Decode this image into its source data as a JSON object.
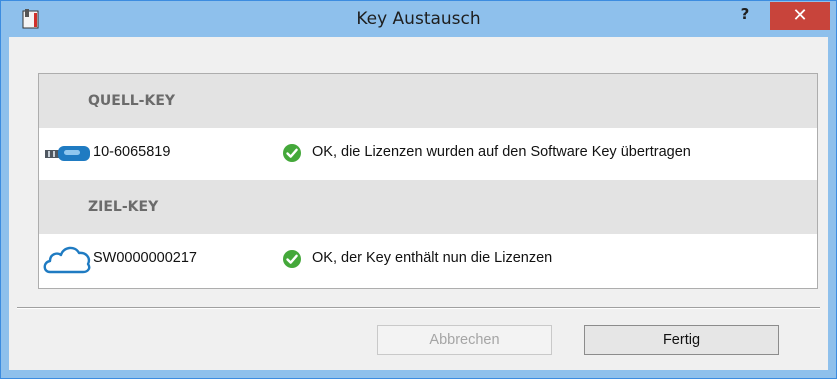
{
  "window": {
    "title": "Key Austausch",
    "help_label": "?",
    "close_label": "✕",
    "colors": {
      "titlebar": "#8ec0ec",
      "close": "#c8443b",
      "ok": "#44a83a"
    }
  },
  "sections": [
    {
      "header": "QUELL-KEY",
      "key_icon": "usb-dongle-icon",
      "key_id": "10-6065819",
      "status_icon": "checkmark-icon",
      "status_text": "OK, die Lizenzen wurden auf den Software Key übertragen"
    },
    {
      "header": "ZIEL-KEY",
      "key_icon": "cloud-icon",
      "key_id": "SW0000000217",
      "status_icon": "checkmark-icon",
      "status_text": "OK, der Key enthält nun die Lizenzen"
    }
  ],
  "buttons": {
    "cancel_label": "Abbrechen",
    "cancel_enabled": false,
    "done_label": "Fertig"
  }
}
